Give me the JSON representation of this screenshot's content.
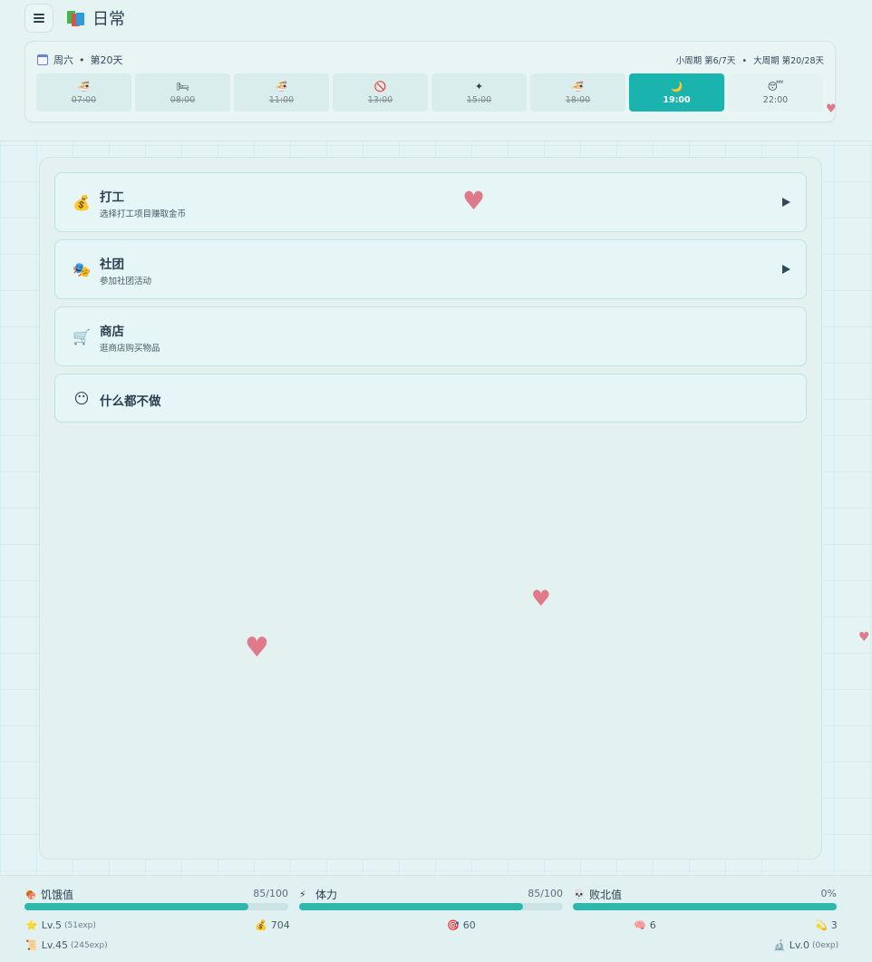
{
  "app": {
    "title": "日常",
    "title_icon": "books-icon"
  },
  "schedule": {
    "weekday": "周六",
    "day": "第20天",
    "small_cycle": "小周期 第6/7天",
    "big_cycle": "大周期 第20/28天",
    "slots": [
      {
        "time": "07:00",
        "icon": "bowl-icon",
        "glyph": "🍜",
        "state": "past"
      },
      {
        "time": "08:00",
        "icon": "bed-icon",
        "glyph": "🛏",
        "state": "past"
      },
      {
        "time": "11:00",
        "icon": "bowl-icon",
        "glyph": "🍜",
        "state": "past"
      },
      {
        "time": "13:00",
        "icon": "no-icon",
        "glyph": "🚫",
        "state": "past"
      },
      {
        "time": "15:00",
        "icon": "sparkle-icon",
        "glyph": "✦",
        "state": "past"
      },
      {
        "time": "18:00",
        "icon": "bowl-icon",
        "glyph": "🍜",
        "state": "past"
      },
      {
        "time": "19:00",
        "icon": "moon-icon",
        "glyph": "🌙",
        "state": "active"
      },
      {
        "time": "22:00",
        "icon": "sleep-icon",
        "glyph": "😴",
        "state": "future"
      }
    ]
  },
  "actions": [
    {
      "title": "打工",
      "desc": "选择打工项目赚取金币",
      "icon": "money-bag-icon",
      "glyph": "💰",
      "arrow": true
    },
    {
      "title": "社团",
      "desc": "参加社团活动",
      "icon": "theater-masks-icon",
      "glyph": "🎭",
      "arrow": true
    },
    {
      "title": "商店",
      "desc": "逛商店购买物品",
      "icon": "shopping-cart-icon",
      "glyph": "🛒",
      "arrow": false
    },
    {
      "title": "什么都不做",
      "desc": "",
      "icon": "face-icon",
      "glyph": "😶",
      "arrow": false
    }
  ],
  "stats": {
    "hunger": {
      "label": "饥饿值",
      "value": "85/100",
      "fraction": 0.85,
      "icon": "meat-icon",
      "glyph": "🍖"
    },
    "stamina": {
      "label": "体力",
      "value": "85/100",
      "fraction": 0.85,
      "icon": "lightning-icon",
      "glyph": "⚡"
    },
    "defeat": {
      "label": "败北值",
      "value": "0%",
      "fraction": 0.0,
      "icon": "skull-icon",
      "glyph": "💀"
    }
  },
  "meta": {
    "level": "Lv.5",
    "level_exp": "(51exp)",
    "gold": "704",
    "target": "60",
    "brain": "6",
    "coins": "3",
    "level2": "Lv.45",
    "level2_exp": "(245exp)",
    "level3": "Lv.0",
    "level3_exp": "(0exp)"
  },
  "colors": {
    "accent": "#1ab3ad",
    "bar_fill": "#2fb7ae",
    "heart": "#e07a8a"
  }
}
